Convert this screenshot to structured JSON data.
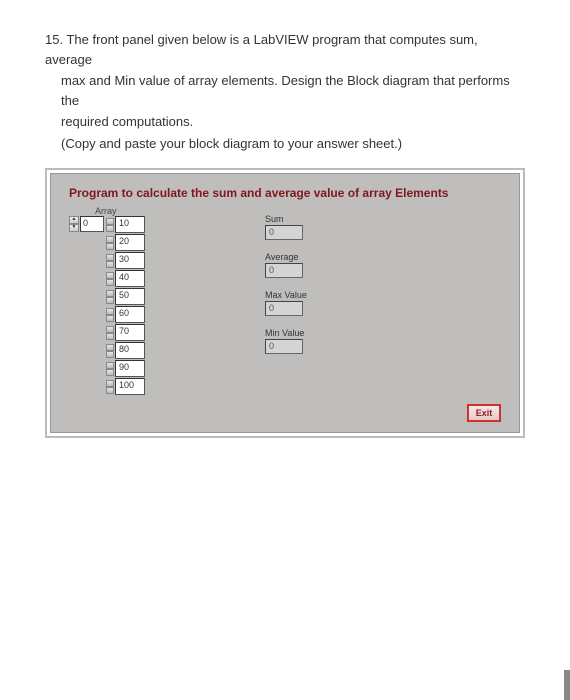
{
  "question": {
    "number": "15.",
    "line1": "The front panel given below is a LabVIEW program that computes sum,  average",
    "line2": "max and Min value of array elements. Design the Block diagram that performs the",
    "line3": "required computations.",
    "line4": "(Copy and paste your block diagram to your answer sheet.)"
  },
  "panel": {
    "title": "Program to calculate the sum and average value of array Elements",
    "array": {
      "label": "Array",
      "index": "0",
      "cells": [
        "10",
        "20",
        "30",
        "40",
        "50",
        "60",
        "70",
        "80",
        "90",
        "100"
      ]
    },
    "outputs": {
      "sum": {
        "label": "Sum",
        "value": "0"
      },
      "avg": {
        "label": "Average",
        "value": "0"
      },
      "max": {
        "label": "Max Value",
        "value": "0"
      },
      "min": {
        "label": "Min Value",
        "value": "0"
      }
    },
    "exit_label": "Exit"
  }
}
